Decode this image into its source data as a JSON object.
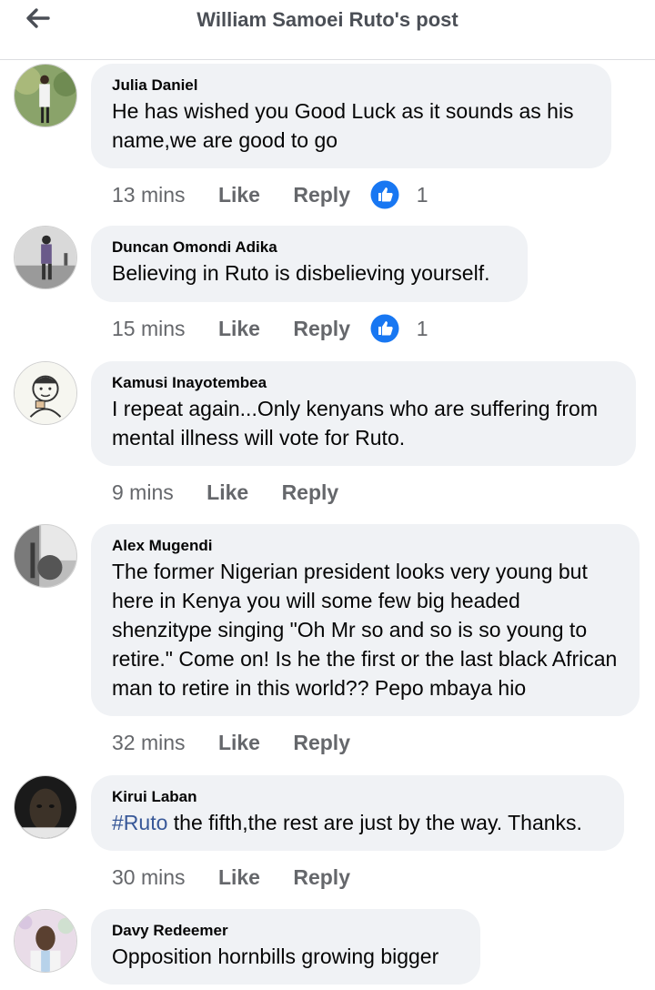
{
  "header": {
    "title": "William Samoei Ruto's post"
  },
  "comments": [
    {
      "author": "Julia Daniel",
      "text": "He has wished you Good Luck as it sounds as his name,we are good to go",
      "time": "13 mins",
      "like": "Like",
      "reply": "Reply",
      "reactions": "1"
    },
    {
      "author": "Duncan Omondi Adika",
      "text": "Believing in Ruto is disbelieving yourself.",
      "time": "15 mins",
      "like": "Like",
      "reply": "Reply",
      "reactions": "1"
    },
    {
      "author": "Kamusi Inayotembea",
      "text": "I repeat again...Only kenyans who are suffering from mental illness will vote for Ruto.",
      "time": "9 mins",
      "like": "Like",
      "reply": "Reply"
    },
    {
      "author": "Alex Mugendi",
      "text": "The former Nigerian president looks very young but here in Kenya you will some few big headed shenzitype singing \"Oh Mr so and so is so young to retire.\" Come on! Is he the first or the last black African man to retire in this world?? Pepo mbaya hio",
      "time": "32 mins",
      "like": "Like",
      "reply": "Reply"
    },
    {
      "author": "Kirui Laban",
      "hashtag": "#Ruto",
      "text": " the fifth,the rest are just by the way. Thanks.",
      "time": "30 mins",
      "like": "Like",
      "reply": "Reply"
    },
    {
      "author": "Davy Redeemer",
      "text": "Opposition hornbills  growing bigger"
    }
  ],
  "colors": {
    "bubble": "#f0f2f5",
    "meta": "#65676b",
    "link": "#385898",
    "like_icon": "#1877f2"
  },
  "icons": {
    "back": "arrow-left-icon",
    "reaction": "thumbs-up-icon"
  }
}
